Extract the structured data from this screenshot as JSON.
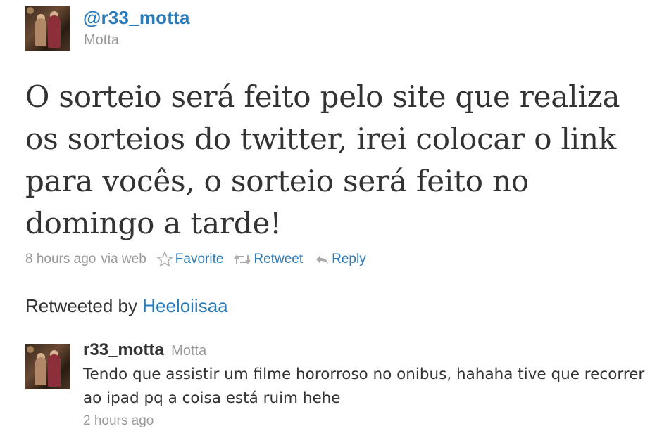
{
  "main_tweet": {
    "screen_name": "@r33_motta",
    "real_name": "Motta",
    "text": "O sorteio será feito pelo site que realiza os sorteios do twitter, irei colocar o link para vocês, o sorteio será feito no domingo a tarde!",
    "timestamp": "8 hours ago",
    "source": "via web",
    "actions": {
      "favorite": "Favorite",
      "retweet": "Retweet",
      "reply": "Reply"
    }
  },
  "retweeted_by": {
    "label": "Retweeted by",
    "user": "Heeloiisaa"
  },
  "second_tweet": {
    "user": "r33_motta",
    "real_name": "Motta",
    "text": "Tendo que assistir um filme hororroso no onibus, hahaha tive que recorrer ao ipad pq a coisa está ruim hehe",
    "timestamp": "2 hours ago"
  },
  "icons": [
    "star-icon",
    "retweet-icon",
    "reply-icon"
  ],
  "colors": {
    "link": "#2b7bb9",
    "text": "#333333",
    "muted": "#999999"
  }
}
